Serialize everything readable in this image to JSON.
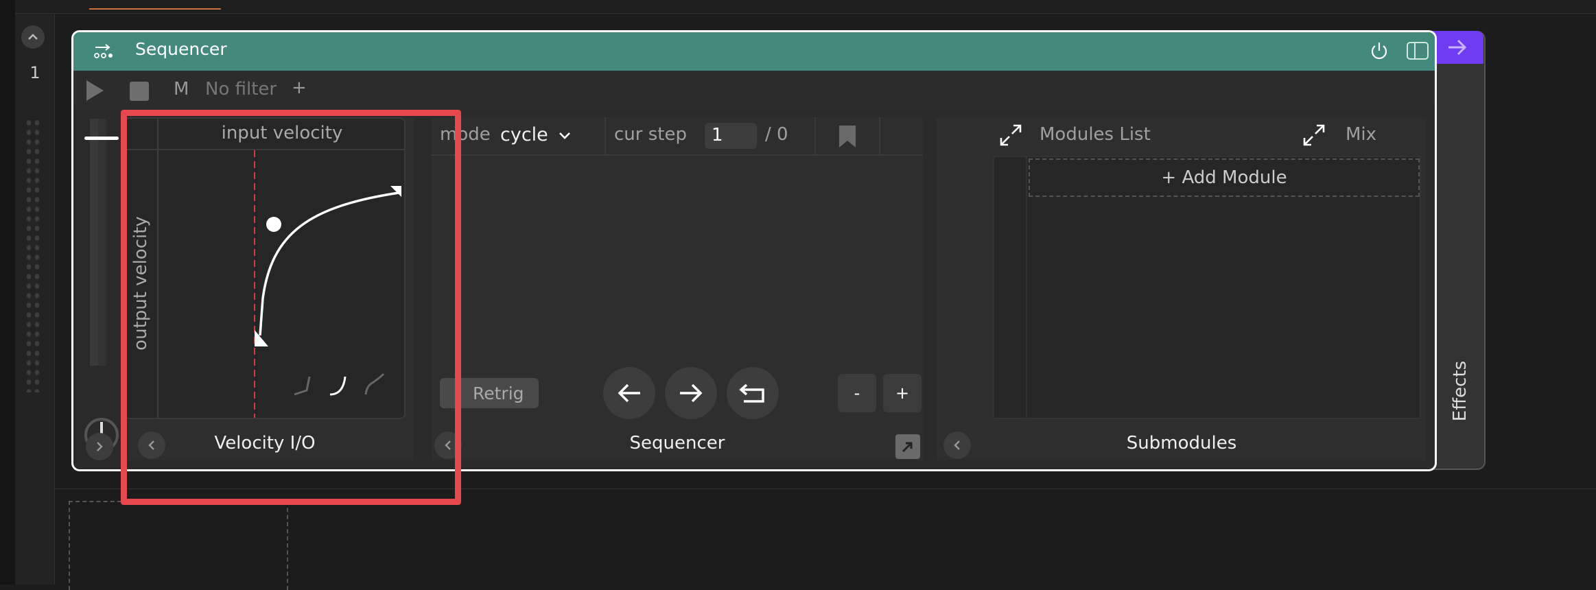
{
  "gutter": {
    "track_number": "1"
  },
  "device": {
    "title": "Sequencer",
    "side_label": "Effects",
    "colors": {
      "header": "#448a7c",
      "accent": "#6f3cf2",
      "highlight": "#e5484d"
    }
  },
  "toolbar": {
    "m_label": "M",
    "filter_label": "No filter",
    "add_label": "+"
  },
  "velocity": {
    "input_label": "input velocity",
    "output_label": "output velocity",
    "panel_title": "Velocity I/O"
  },
  "sequencer": {
    "mode_label": "mode",
    "mode_value": "cycle",
    "cur_step_label": "cur step",
    "cur_step_value": "1",
    "total_steps": "/ 0",
    "retrig_label": "Retrig",
    "minus_label": "-",
    "plus_label": "+",
    "panel_title": "Sequencer"
  },
  "submodules": {
    "modules_list_label": "Modules List",
    "mix_label": "Mix",
    "add_module_label": "+ Add Module",
    "panel_title": "Submodules"
  }
}
